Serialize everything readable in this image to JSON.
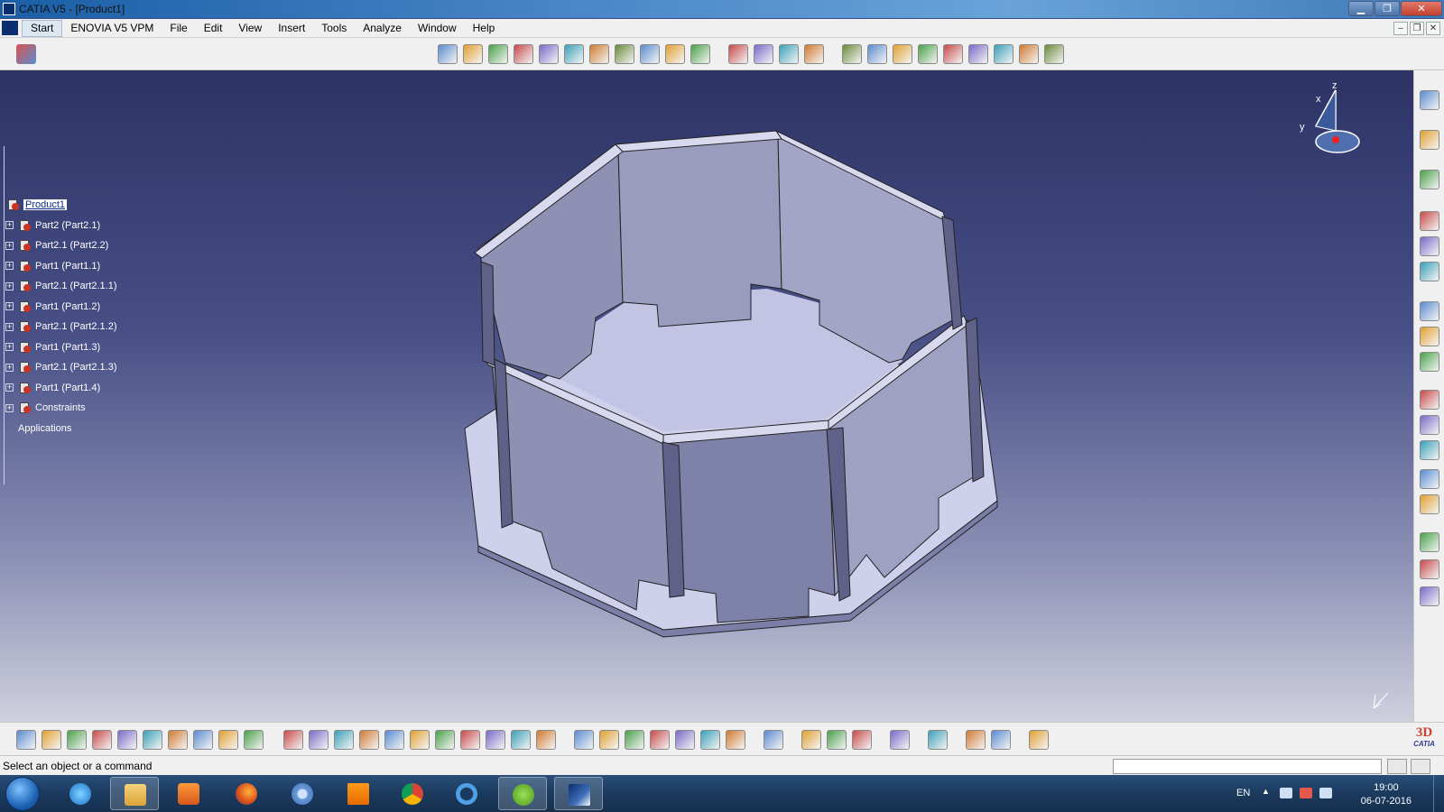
{
  "window": {
    "title": "CATIA V5 - [Product1]"
  },
  "menu": {
    "items": [
      "Start",
      "ENOVIA V5 VPM",
      "File",
      "Edit",
      "View",
      "Insert",
      "Tools",
      "Analyze",
      "Window",
      "Help"
    ]
  },
  "tree": {
    "root": "Product1",
    "items": [
      "Part2 (Part2.1)",
      "Part2.1 (Part2.2)",
      "Part1 (Part1.1)",
      "Part2.1 (Part2.1.1)",
      "Part1 (Part1.2)",
      "Part2.1 (Part2.1.2)",
      "Part1 (Part1.3)",
      "Part2.1 (Part2.1.3)",
      "Part1 (Part1.4)",
      "Constraints"
    ],
    "applications": "Applications"
  },
  "compass": {
    "x": "x",
    "y": "y",
    "z": "z"
  },
  "status": {
    "message": "Select an object or a command",
    "command_input": ""
  },
  "taskbar": {
    "language": "EN",
    "time": "19:00",
    "date": "06-07-2016"
  },
  "brand": {
    "logo": "CATIA"
  },
  "colors": {
    "title_bar": "#4a86c8",
    "viewport_top": "#2d3365",
    "viewport_bottom": "#cfd0de",
    "model_face": "#a7a8c8",
    "model_plate": "#cfd0ec"
  },
  "icons": {
    "top_toolbar": [
      "assembly-icon",
      "insert-product-icon",
      "insert-part-icon",
      "existing-component-icon",
      "replace-icon",
      "graph-tree-icon",
      "generate-numbering-icon",
      "manipulation-icon",
      "snap-icon",
      "explode-icon",
      "stop-manipulation-icon",
      "clash-icon",
      "coincidence-constraint-icon",
      "contact-constraint-icon",
      "offset-constraint-icon",
      "angle-constraint-icon",
      "fix-icon",
      "fix-together-icon",
      "quick-constraint-icon",
      "flexible-icon",
      "change-constraint-icon",
      "reuse-pattern-icon",
      "update-icon",
      "multi-instantiation-icon"
    ],
    "right_toolbar": [
      "catalog-icon",
      "select-icon",
      "product-manage-icon",
      "new-component-icon",
      "new-product-icon",
      "new-part-icon",
      "existing-icon",
      "replace-component-icon",
      "reorder-icon",
      "annotation-icon",
      "text-icon",
      "flag-icon",
      "weld-icon",
      "scene-icon",
      "enhanced-scene-icon",
      "bom-icon",
      "tree-icon"
    ],
    "bottom_toolbar": [
      "new-icon",
      "open-icon",
      "save-icon",
      "print-icon",
      "cut-icon",
      "copy-icon",
      "paste-icon",
      "undo-icon",
      "redo-icon",
      "whats-this-icon",
      "formula-icon",
      "knowledge-icon",
      "macro-icon",
      "table-icon",
      "lock-icon",
      "selection-icon",
      "fly-icon",
      "fit-all-icon",
      "pan-icon",
      "rotate-icon",
      "zoom-in-icon",
      "zoom-out-icon",
      "normal-view-icon",
      "multi-view-icon",
      "iso-view-icon",
      "hide-show-icon",
      "swap-icon",
      "shading-icon",
      "camera-icon",
      "measure-icon",
      "measure-item-icon",
      "measure-inertia-icon",
      "refresh-icon",
      "compass-icon",
      "render-icon",
      "material-icon",
      "grid-icon"
    ]
  }
}
